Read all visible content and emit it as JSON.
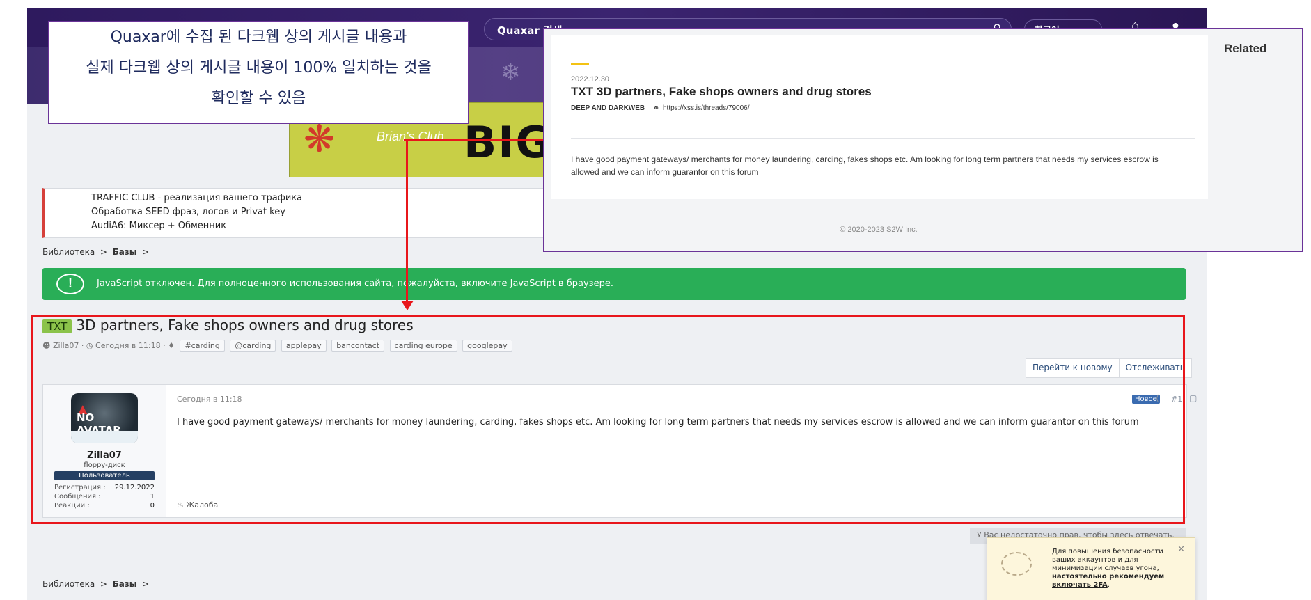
{
  "forum": {
    "search_text": "Quaxar 검색",
    "lang_label": "한국어",
    "ad": {
      "brand": "Brian's Club",
      "big_text": "BIG"
    },
    "traffic_links": [
      "TRAFFIC CLUB - реализация вашего трафика",
      "Обработка SEED фраз, логов и Privat key",
      "AudiA6: Миксер + Обменник"
    ],
    "breadcrumb": {
      "library": "Библиотека",
      "sep": ">",
      "current": "Базы"
    },
    "js_warning": "JavaScript отключен. Для полноценного использования сайта, пожалуйста, включите JavaScript в браузере.",
    "thread": {
      "prefix": "TXT",
      "title": "3D partners, Fake shops owners and drug stores",
      "author": "Zilla07",
      "time": "Сегодня в 11:18",
      "tags": [
        "#carding",
        "@carding",
        "applepay",
        "bancontact",
        "carding europe",
        "googlepay"
      ]
    },
    "actions": {
      "goto_new": "Перейти к новому",
      "watch": "Отслеживать"
    },
    "post": {
      "avatar_text": "NO AVATAR",
      "username": "Zilla07",
      "user_title": "floppy-диск",
      "user_banner": "Пользователь",
      "stats": [
        {
          "label": "Регистрация :",
          "value": "29.12.2022"
        },
        {
          "label": "Сообщения :",
          "value": "1"
        },
        {
          "label": "Реакции :",
          "value": "0"
        }
      ],
      "date": "Сегодня в 11:18",
      "new_badge": "Новое",
      "number": "#1",
      "body": "I have good payment gateways/ merchants for money laundering, carding, fakes shops etc. Am looking for long term partners that needs my services escrow is allowed and we can inform guarantor on this forum",
      "report": "Жалоба"
    },
    "no_reply": "У Вас недостаточно прав, чтобы здесь отвечать.",
    "twofa_popup": {
      "line1": "Для повышения безопасности ваших аккаунтов и для минимизации случаев угона,",
      "bold": "настоятельно рекомендуем",
      "link": "включать 2FA",
      "tail": "."
    }
  },
  "callout": {
    "lines": [
      "Quaxar에 수집 된 다크웹 상의 게시글 내용과",
      "실제 다크웹 상의 게시글 내용이 100% 일치하는 것을",
      "확인할 수 있음"
    ]
  },
  "quaxar": {
    "date": "2022.12.30",
    "title": "TXT 3D partners, Fake shops owners and drug stores",
    "source": "DEEP AND DARKWEB",
    "url": "https://xss.is/threads/79006/",
    "body": "I have good payment gateways/ merchants for money laundering, carding, fakes shops etc. Am looking for long term partners that needs my services escrow is allowed and we can inform guarantor on this forum",
    "copyright": "© 2020-2023 S2W Inc.",
    "related": "Related"
  },
  "colors": {
    "highlight_red": "#e8161b",
    "callout_purple": "#6a3398",
    "js_green": "#29ae57",
    "accent_yellow": "#f3c213"
  }
}
